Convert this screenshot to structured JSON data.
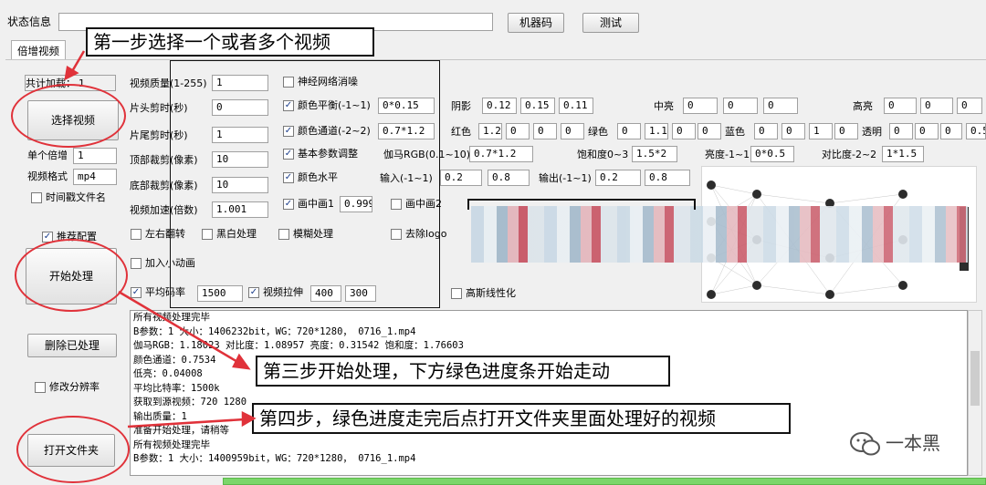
{
  "status_bar": {
    "label": "状态信息",
    "value": "",
    "machine_code_button": "机器码",
    "test_button": "测试"
  },
  "tab": "倍增视频",
  "left_panel": {
    "total_loaded_label": "共计加载：",
    "total_loaded_value": "1",
    "select_video_button": "选择视频",
    "single_multiplier_label": "单个倍增",
    "single_multiplier_value": "1",
    "video_format_label": "视频格式",
    "video_format_value": "mp4",
    "timestamp_filename": "时间戳文件名",
    "recommended_config": "推荐配置",
    "start_button": "开始处理",
    "delete_processed_button": "删除已处理",
    "modify_resolution": "修改分辨率",
    "open_folder_button": "打开文件夹"
  },
  "params": {
    "quality_label": "视频质量(1-255)",
    "quality_value": "1",
    "head_cut_label": "片头剪时(秒)",
    "head_cut_value": "0",
    "tail_cut_label": "片尾剪时(秒)",
    "tail_cut_value": "1",
    "top_crop_label": "顶部裁剪(像素)",
    "top_crop_value": "10",
    "bottom_crop_label": "底部裁剪(像素)",
    "bottom_crop_value": "10",
    "speed_label": "视频加速(倍数)",
    "speed_value": "1.001",
    "flip_label": "左右翻转",
    "bw_label": "黑白处理",
    "blur_label": "模糊处理",
    "remove_logo_label": "去除logo",
    "add_animation_label": "加入小动画",
    "avg_bitrate_label": "平均码率",
    "avg_bitrate_value": "1500",
    "stretch_label": "视频拉伸",
    "stretch_w": "400",
    "stretch_h": "300",
    "neural_denoise_label": "神经网络消噪",
    "color_balance_label": "颜色平衡(-1~1)",
    "color_balance_value": "0*0.15",
    "color_channel_label": "颜色通道(-2~2)",
    "color_channel_value": "0.7*1.2",
    "basic_params_label": "基本参数调整",
    "color_level_label": "颜色水平",
    "pip1_label": "画中画1",
    "pip1_value": "0.999",
    "pip2_label": "画中画2",
    "gauss_label": "高斯线性化",
    "shadow_label": "阴影",
    "shadow_values": [
      "0.12",
      "0.15",
      "0.11"
    ],
    "mid_label": "中亮",
    "mid_values": [
      "0",
      "0",
      "0"
    ],
    "high_label": "高亮",
    "high_values": [
      "0",
      "0",
      "0"
    ],
    "red_label": "红色",
    "red_values": [
      "1.2",
      "0",
      "0",
      "0"
    ],
    "green_label": "绿色",
    "green_values": [
      "0",
      "1.1",
      "0",
      "0"
    ],
    "blue_label": "蓝色",
    "blue_values": [
      "0",
      "0",
      "1",
      "0"
    ],
    "transparent_label": "透明",
    "transparent_values": [
      "0",
      "0",
      "0",
      "0.5"
    ],
    "gamma_label": "伽马RGB(0.1~10)",
    "gamma_value": "0.7*1.2",
    "saturation_label": "饱和度0~3",
    "saturation_value": "1.5*2",
    "brightness_label": "亮度-1~1",
    "brightness_value": "0*0.5",
    "contrast_label": "对比度-2~2",
    "contrast_value": "1*1.5",
    "input_label": "输入(-1~1)",
    "input_values": [
      "0.2",
      "0.8"
    ],
    "output_label": "输出(-1~1)",
    "output_values": [
      "0.2",
      "0.8"
    ]
  },
  "log": [
    "所有视频处理完毕",
    "B参数：1  大小：1406232bit，WG：720*1280，  0716_1.mp4",
    "伽马RGB：1.18023 对比度：1.08957 亮度：0.31542 饱和度：1.76603",
    "颜色通道：0.7534",
    "低亮：0.04008",
    "平均比特率：1500k",
    "获取到源视频：720   1280",
    "输出质量：1",
    "准备开始处理，请稍等",
    "所有视频处理完毕",
    "B参数：1  大小：1400959bit，WG：720*1280，  0716_1.mp4"
  ],
  "callouts": {
    "step1": "第一步选择一个或者多个视频",
    "step3": "第三步开始处理，下方绿色进度条开始走动",
    "step4": "第四步，绿色进度走完后点打开文件夹里面处理好的视频"
  },
  "watermark": "一本黑",
  "colors": {
    "annotation_red": "#e0323a",
    "progress_green": "#7bd66a",
    "checkbox_blue": "#1a3c8a"
  }
}
